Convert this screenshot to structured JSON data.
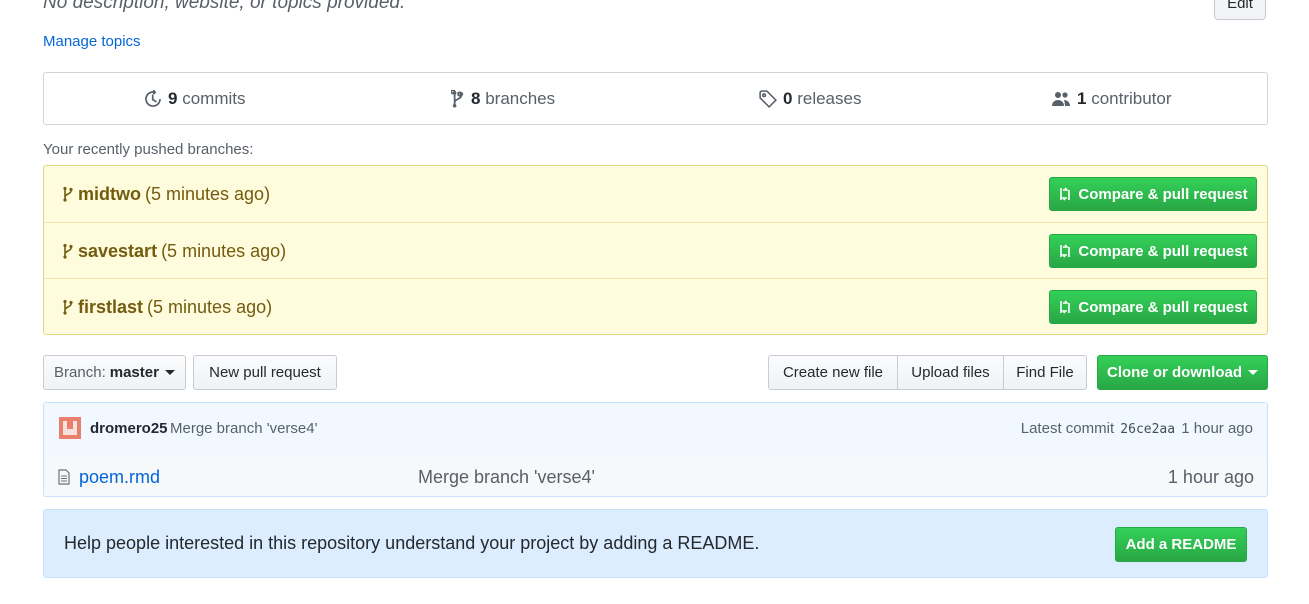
{
  "repo": {
    "description": "No description, website, or topics provided.",
    "edit_label": "Edit",
    "manage_topics": "Manage topics"
  },
  "numbers": {
    "commits_count": "9",
    "commits_label": "commits",
    "branches_count": "8",
    "branches_label": "branches",
    "releases_count": "0",
    "releases_label": "releases",
    "contributors_count": "1",
    "contributors_label": "contributor"
  },
  "recent": {
    "label": "Your recently pushed branches:",
    "compare_label": "Compare & pull request",
    "branches": [
      {
        "name": "midtwo",
        "time": "(5 minutes ago)"
      },
      {
        "name": "savestart",
        "time": "(5 minutes ago)"
      },
      {
        "name": "firstlast",
        "time": "(5 minutes ago)"
      }
    ]
  },
  "toolbar": {
    "branch_prefix": "Branch:",
    "branch_name": "master",
    "new_pr": "New pull request",
    "create_file": "Create new file",
    "upload_files": "Upload files",
    "find_file": "Find File",
    "clone": "Clone or download"
  },
  "commit": {
    "author": "dromero25",
    "message": "Merge branch 'verse4'",
    "latest_prefix": "Latest commit",
    "sha": "26ce2aa",
    "age": "1 hour ago"
  },
  "files": [
    {
      "name": "poem.rmd",
      "message": "Merge branch 'verse4'",
      "age": "1 hour ago"
    }
  ],
  "readme": {
    "text": "Help people interested in this repository understand your project by adding a README.",
    "button": "Add a README"
  },
  "colors": {
    "primary_green": "#28a745",
    "link_blue": "#0366d6",
    "recent_bg": "#fffbdd",
    "readme_bg": "#dbedff"
  }
}
